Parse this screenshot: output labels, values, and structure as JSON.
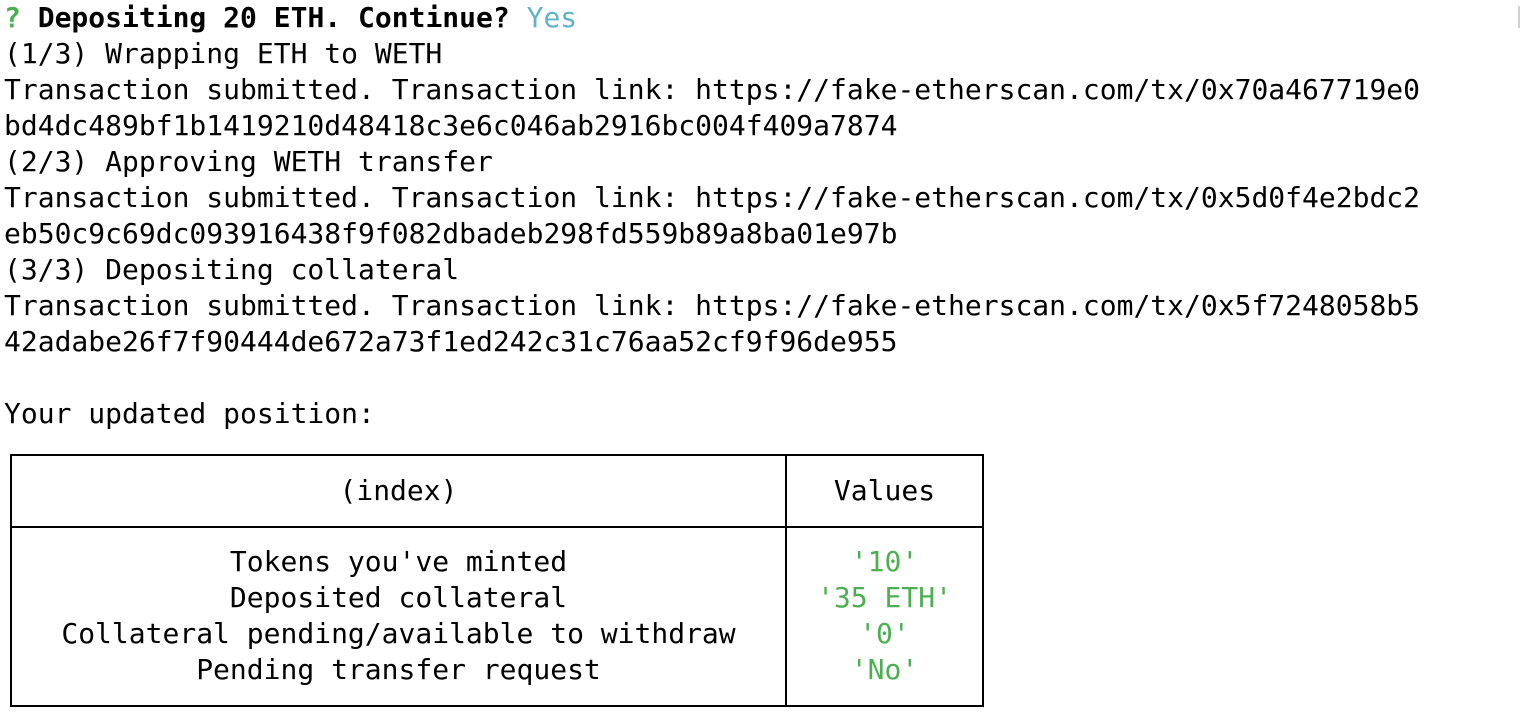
{
  "terminal": {
    "prompt": {
      "symbol": "?",
      "question": "Depositing 20 ETH. Continue?",
      "answer": "Yes"
    },
    "lines": [
      "(1/3) Wrapping ETH to WETH",
      "Transaction submitted. Transaction link: https://fake-etherscan.com/tx/0x70a467719e0",
      "bd4dc489bf1b1419210d48418c3e6c046ab2916bc004f409a7874",
      "(2/3) Approving WETH transfer",
      "Transaction submitted. Transaction link: https://fake-etherscan.com/tx/0x5d0f4e2bdc2",
      "eb50c9c69dc093916438f9f082dbadeb298fd559b89a8ba01e97b",
      "(3/3) Depositing collateral",
      "Transaction submitted. Transaction link: https://fake-etherscan.com/tx/0x5f7248058b5",
      "42adabe26f7f90444de672a73f1ed242c31c76aa52cf9f96de955"
    ],
    "position_heading": "Your updated position:"
  },
  "table": {
    "headers": [
      "(index)",
      "Values"
    ],
    "rows": [
      {
        "index": "Tokens you've minted",
        "value": "'10'"
      },
      {
        "index": "Deposited collateral",
        "value": "'35 ETH'"
      },
      {
        "index": "Collateral pending/available to withdraw",
        "value": "'0'"
      },
      {
        "index": "Pending transfer request",
        "value": "'No'"
      }
    ]
  },
  "colors": {
    "prompt_symbol": "#4caf50",
    "answer": "#5fb3c7",
    "value_text": "#4caf50",
    "foreground": "#000000",
    "background": "#ffffff"
  }
}
